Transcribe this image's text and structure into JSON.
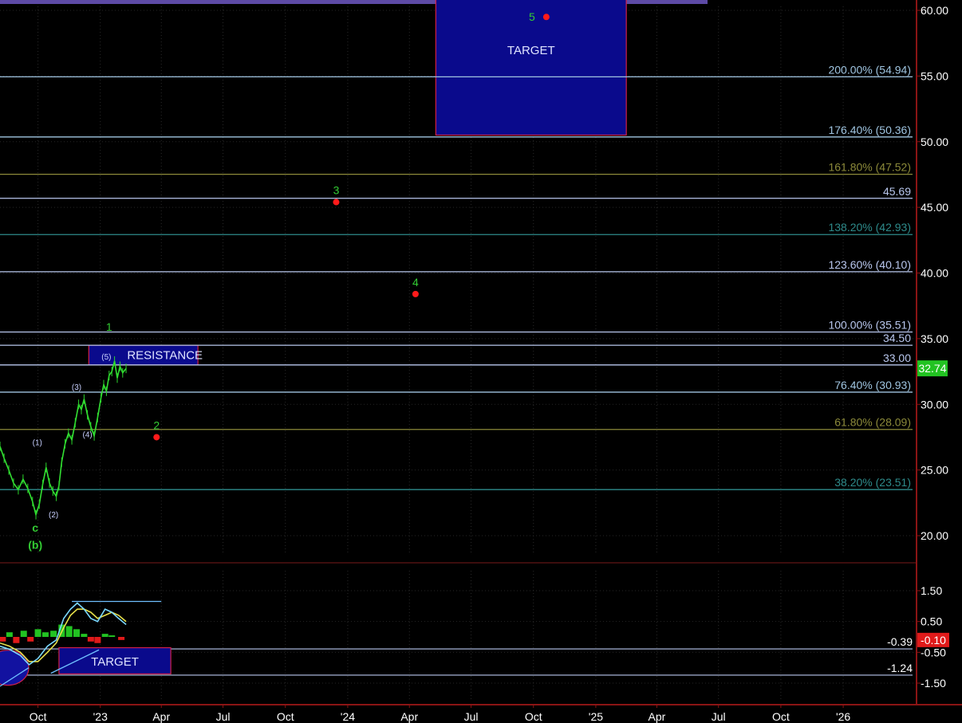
{
  "chart_data": [
    {
      "type": "line",
      "panel": "price",
      "ylim": [
        18,
        61
      ],
      "y_ticks": [
        "60.00",
        "55.00",
        "50.00",
        "45.00",
        "40.00",
        "35.00",
        "30.00",
        "25.00",
        "20.00"
      ],
      "y_tick_values": [
        60,
        55,
        50,
        45,
        40,
        35,
        30,
        25,
        20
      ],
      "x_ticks": [
        "Oct",
        "'23",
        "Apr",
        "Jul",
        "Oct",
        "'24",
        "Apr",
        "Jul",
        "Oct",
        "'25",
        "Apr",
        "Jul",
        "Oct",
        "'26"
      ],
      "x_tick_values": [
        "2022-10-01",
        "2023-01-01",
        "2023-04-01",
        "2023-07-01",
        "2023-10-01",
        "2024-01-01",
        "2024-04-01",
        "2024-07-01",
        "2024-10-01",
        "2025-01-01",
        "2025-04-01",
        "2025-07-01",
        "2025-10-01",
        "2026-01-01"
      ],
      "xlim": [
        "2022-08-06",
        "2026-04-18"
      ],
      "price_series": [
        [
          "2022-08-06",
          26.8
        ],
        [
          "2022-08-12",
          25.9
        ],
        [
          "2022-08-19",
          25.0
        ],
        [
          "2022-08-26",
          24.0
        ],
        [
          "2022-09-02",
          23.5
        ],
        [
          "2022-09-09",
          24.3
        ],
        [
          "2022-09-16",
          23.6
        ],
        [
          "2022-09-23",
          22.6
        ],
        [
          "2022-09-28",
          21.6
        ],
        [
          "2022-10-03",
          22.4
        ],
        [
          "2022-10-08",
          23.9
        ],
        [
          "2022-10-13",
          25.2
        ],
        [
          "2022-10-18",
          24.0
        ],
        [
          "2022-10-23",
          23.4
        ],
        [
          "2022-10-28",
          23.0
        ],
        [
          "2022-11-01",
          23.8
        ],
        [
          "2022-11-05",
          25.6
        ],
        [
          "2022-11-10",
          27.0
        ],
        [
          "2022-11-15",
          27.8
        ],
        [
          "2022-11-20",
          27.3
        ],
        [
          "2022-11-25",
          28.6
        ],
        [
          "2022-11-30",
          30.0
        ],
        [
          "2022-12-04",
          29.6
        ],
        [
          "2022-12-08",
          30.4
        ],
        [
          "2022-12-13",
          29.2
        ],
        [
          "2022-12-18",
          28.3
        ],
        [
          "2022-12-23",
          27.6
        ],
        [
          "2022-12-28",
          29.0
        ],
        [
          "2023-01-02",
          30.5
        ],
        [
          "2023-01-06",
          31.5
        ],
        [
          "2023-01-10",
          31.0
        ],
        [
          "2023-01-14",
          32.2
        ],
        [
          "2023-01-18",
          32.5
        ],
        [
          "2023-01-22",
          33.3
        ],
        [
          "2023-01-26",
          32.0
        ],
        [
          "2023-01-30",
          32.9
        ],
        [
          "2023-02-03",
          32.4
        ],
        [
          "2023-02-08",
          32.74
        ]
      ],
      "fib_levels": [
        {
          "label": "200.00% (54.94)",
          "value": 54.94,
          "color": "#9fc4e0"
        },
        {
          "label": "176.40% (50.36)",
          "value": 50.36,
          "color": "#9fc4e0"
        },
        {
          "label": "161.80% (47.52)",
          "value": 47.52,
          "color": "#8c8a3a"
        },
        {
          "label": "45.69",
          "value": 45.69,
          "color": "#b9c7ee"
        },
        {
          "label": "138.20% (42.93)",
          "value": 42.93,
          "color": "#2e8b8b"
        },
        {
          "label": "123.60% (40.10)",
          "value": 40.1,
          "color": "#b9c7ee"
        },
        {
          "label": "100.00% (35.51)",
          "value": 35.51,
          "color": "#b9c7ee"
        },
        {
          "label": "34.50",
          "value": 34.5,
          "color": "#b9c7ee"
        },
        {
          "label": "33.00",
          "value": 33.0,
          "color": "#b9c7ee"
        },
        {
          "label": "76.40% (30.93)",
          "value": 30.93,
          "color": "#9fc4e0"
        },
        {
          "label": "61.80% (28.09)",
          "value": 28.09,
          "color": "#8c8a3a"
        },
        {
          "label": "38.20% (23.51)",
          "value": 23.51,
          "color": "#2e8b8b"
        }
      ],
      "last_price": "32.74",
      "projected_points": [
        {
          "label": "2",
          "date": "2023-03-25",
          "value": 27.5
        },
        {
          "label": "3",
          "date": "2023-12-15",
          "value": 45.4
        },
        {
          "label": "4",
          "date": "2024-04-10",
          "value": 38.4
        },
        {
          "label": "5",
          "date": "2024-10-20",
          "value": 59.5
        }
      ],
      "wave_labels": [
        {
          "label": "1",
          "date": "2023-01-14",
          "value": 35.6,
          "color": "#33cc33"
        },
        {
          "label": "(5)",
          "date": "2023-01-10",
          "value": 33.4,
          "color": "#c8d0ff"
        },
        {
          "label": "(3)",
          "date": "2022-11-27",
          "value": 31.1,
          "color": "#c8d0ff"
        },
        {
          "label": "(4)",
          "date": "2022-12-13",
          "value": 27.5,
          "color": "#c8d0ff"
        },
        {
          "label": "(1)",
          "date": "2022-09-30",
          "value": 26.9,
          "color": "#c8d0ff"
        },
        {
          "label": "(2)",
          "date": "2022-10-24",
          "value": 21.4,
          "color": "#c8d0ff"
        },
        {
          "label": "c",
          "date": "2022-09-27",
          "value": 20.3,
          "color": "#33cc33"
        },
        {
          "label": "(b)",
          "date": "2022-09-27",
          "value": 19.0,
          "color": "#33cc33"
        }
      ],
      "boxes": [
        {
          "label": "TARGET",
          "date_start": "2024-05-10",
          "date_end": "2025-02-15",
          "y_top": 61,
          "y_bottom": 50.5
        },
        {
          "label": "RESISTANCE",
          "date_start": "2022-12-15",
          "date_end": "2023-05-25",
          "y_top": 34.5,
          "y_bottom": 33.0
        }
      ]
    },
    {
      "type": "line",
      "panel": "oscillator",
      "ylim": [
        -2.0,
        2.0
      ],
      "y_ticks": [
        "1.50",
        "0.50",
        "-0.50",
        "-1.50"
      ],
      "y_tick_values": [
        1.5,
        0.5,
        -0.5,
        -1.5
      ],
      "levels": [
        {
          "label": "-0.39",
          "value": -0.39
        },
        {
          "label": "-1.24",
          "value": -1.24
        }
      ],
      "last_value": "-0.10",
      "target_box": {
        "label": "TARGET",
        "date_start": "2022-11-01",
        "date_end": "2023-04-15",
        "y_top": -0.35,
        "y_bottom": -1.2
      },
      "fast_line": [
        [
          "2022-08-06",
          -0.3
        ],
        [
          "2022-08-20",
          -0.4
        ],
        [
          "2022-09-05",
          -0.6
        ],
        [
          "2022-09-18",
          -0.9
        ],
        [
          "2022-10-01",
          -0.7
        ],
        [
          "2022-10-15",
          -0.3
        ],
        [
          "2022-10-28",
          -0.1
        ],
        [
          "2022-11-08",
          0.6
        ],
        [
          "2022-11-18",
          0.9
        ],
        [
          "2022-11-28",
          1.1
        ],
        [
          "2022-12-08",
          0.9
        ],
        [
          "2022-12-18",
          0.6
        ],
        [
          "2022-12-28",
          0.5
        ],
        [
          "2023-01-08",
          0.9
        ],
        [
          "2023-01-18",
          0.8
        ],
        [
          "2023-01-28",
          0.6
        ],
        [
          "2023-02-08",
          0.4
        ]
      ],
      "slow_line": [
        [
          "2022-08-06",
          -0.2
        ],
        [
          "2022-08-20",
          -0.3
        ],
        [
          "2022-09-05",
          -0.5
        ],
        [
          "2022-09-18",
          -0.8
        ],
        [
          "2022-10-01",
          -0.8
        ],
        [
          "2022-10-15",
          -0.5
        ],
        [
          "2022-10-28",
          -0.2
        ],
        [
          "2022-11-08",
          0.3
        ],
        [
          "2022-11-18",
          0.7
        ],
        [
          "2022-11-28",
          0.9
        ],
        [
          "2022-12-08",
          0.9
        ],
        [
          "2022-12-18",
          0.8
        ],
        [
          "2022-12-28",
          0.6
        ],
        [
          "2023-01-08",
          0.7
        ],
        [
          "2023-01-18",
          0.8
        ],
        [
          "2023-01-28",
          0.7
        ],
        [
          "2023-02-08",
          0.5
        ]
      ],
      "histogram": [
        [
          "2022-08-10",
          -0.15
        ],
        [
          "2022-08-20",
          0.15
        ],
        [
          "2022-08-30",
          -0.2
        ],
        [
          "2022-09-10",
          0.2
        ],
        [
          "2022-09-20",
          -0.15
        ],
        [
          "2022-10-01",
          0.25
        ],
        [
          "2022-10-12",
          0.15
        ],
        [
          "2022-10-24",
          0.2
        ],
        [
          "2022-11-05",
          0.4
        ],
        [
          "2022-11-16",
          0.35
        ],
        [
          "2022-11-27",
          0.25
        ],
        [
          "2022-12-08",
          0.1
        ],
        [
          "2022-12-18",
          -0.15
        ],
        [
          "2022-12-28",
          -0.2
        ],
        [
          "2023-01-08",
          0.1
        ],
        [
          "2023-01-18",
          0.05
        ],
        [
          "2023-02-01",
          -0.1
        ]
      ],
      "resistance_line": {
        "date_start": "2022-11-20",
        "date_end": "2023-04-01",
        "value": 1.15
      },
      "support_line": [
        [
          "2022-10-20",
          -1.18
        ],
        [
          "2022-12-30",
          -0.42
        ]
      ]
    }
  ]
}
